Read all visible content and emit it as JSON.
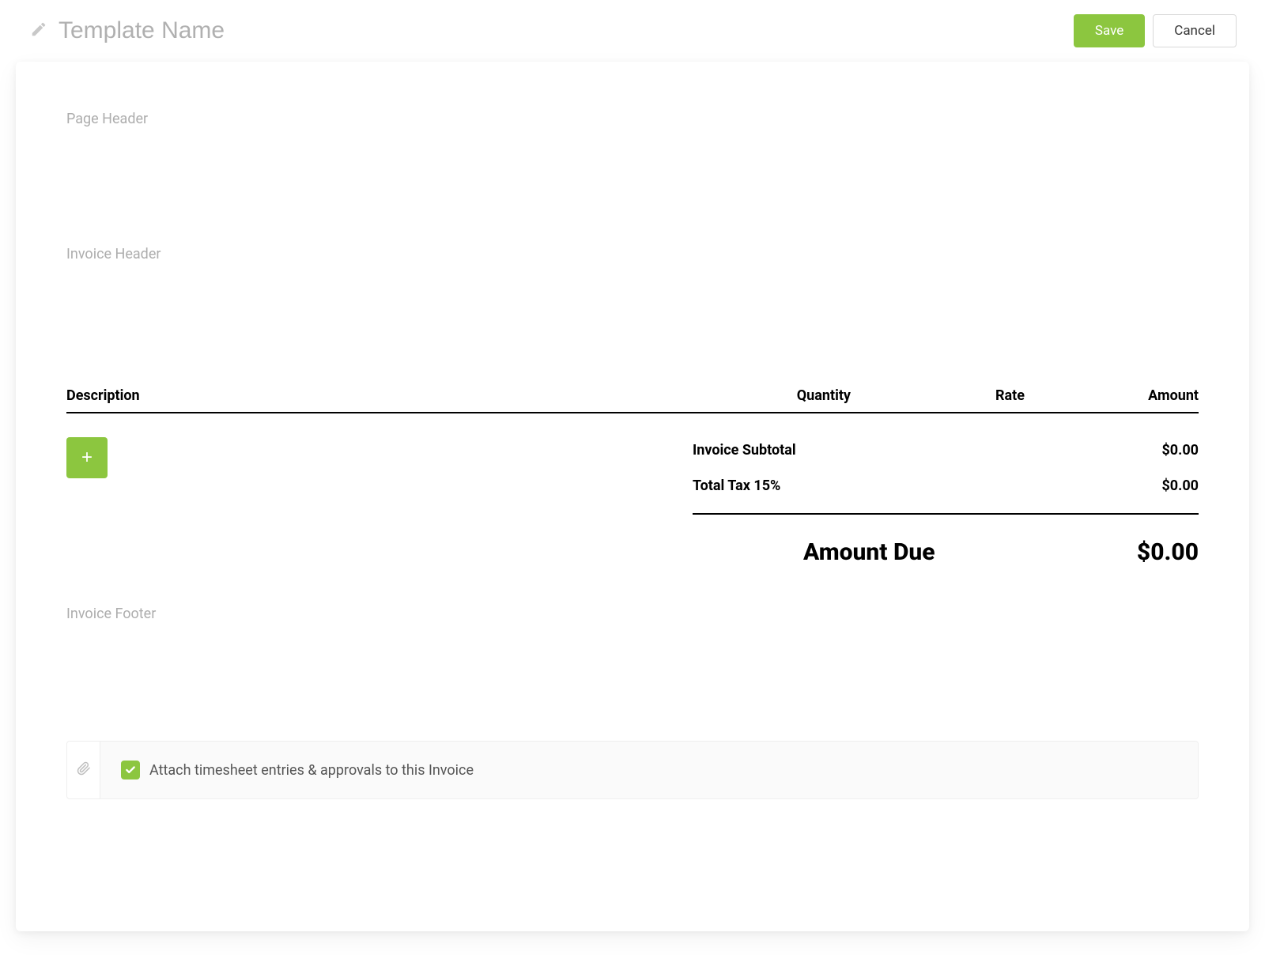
{
  "colors": {
    "accent": "#8CC63F"
  },
  "header": {
    "template_name_placeholder": "Template Name",
    "save_label": "Save",
    "cancel_label": "Cancel"
  },
  "doc": {
    "page_header_placeholder": "Page Header",
    "invoice_header_placeholder": "Invoice Header",
    "invoice_footer_placeholder": "Invoice Footer",
    "columns": {
      "description": "Description",
      "quantity": "Quantity",
      "rate": "Rate",
      "amount": "Amount"
    },
    "totals": {
      "subtotal_label": "Invoice Subtotal",
      "subtotal_value": "$0.00",
      "tax_label": "Total Tax 15%",
      "tax_value": "$0.00",
      "due_label": "Amount Due",
      "due_value": "$0.00"
    },
    "attach": {
      "checked": true,
      "label": "Attach timesheet entries & approvals to this Invoice"
    }
  }
}
